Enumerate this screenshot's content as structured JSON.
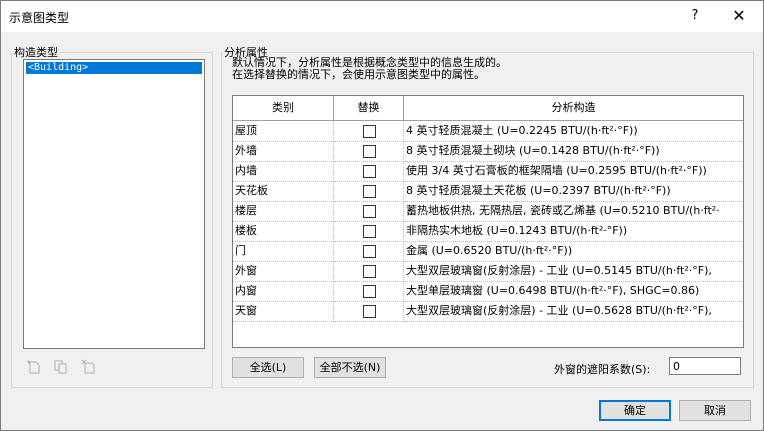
{
  "window": {
    "title": "示意图类型",
    "help_label": "?",
    "close_label": "✕"
  },
  "construction": {
    "legend": "构造类型",
    "items": [
      "<Building>"
    ],
    "icons": [
      "new-type-icon",
      "duplicate-type-icon",
      "delete-type-icon"
    ]
  },
  "analytic": {
    "legend": "分析属性",
    "desc_line1": "默认情况下，分析属性是根据概念类型中的信息生成的。",
    "desc_line2": "在选择替换的情况下，会使用示意图类型中的属性。",
    "headers": {
      "category": "类别",
      "override": "替换",
      "construction": "分析构造"
    },
    "rows": [
      {
        "category": "屋顶",
        "override": false,
        "construction": "4 英寸轻质混凝土 (U=0.2245 BTU/(h·ft²·°F))"
      },
      {
        "category": "外墙",
        "override": false,
        "construction": "8 英寸轻质混凝土砌块 (U=0.1428 BTU/(h·ft²·°F))"
      },
      {
        "category": "内墙",
        "override": false,
        "construction": "使用 3/4 英寸石膏板的框架隔墙 (U=0.2595 BTU/(h·ft²·°F))"
      },
      {
        "category": "天花板",
        "override": false,
        "construction": "8 英寸轻质混凝土天花板 (U=0.2397 BTU/(h·ft²·°F))"
      },
      {
        "category": "楼层",
        "override": false,
        "construction": "蓄热地板供热, 无隔热层, 瓷砖或乙烯基 (U=0.5210 BTU/(h·ft²·"
      },
      {
        "category": "楼板",
        "override": false,
        "construction": "非隔热实木地板 (U=0.1243 BTU/(h·ft²·°F))"
      },
      {
        "category": "门",
        "override": false,
        "construction": "金属 (U=0.6520 BTU/(h·ft²·°F))"
      },
      {
        "category": "外窗",
        "override": false,
        "construction": "大型双层玻璃窗(反射涂层) - 工业 (U=0.5145 BTU/(h·ft²·°F),"
      },
      {
        "category": "内窗",
        "override": false,
        "construction": "大型单层玻璃窗 (U=0.6498 BTU/(h·ft²·°F), SHGC=0.86)"
      },
      {
        "category": "天窗",
        "override": false,
        "construction": "大型双层玻璃窗(反射涂层) - 工业 (U=0.5628 BTU/(h·ft²·°F),"
      }
    ],
    "select_all_label": "全选(L)",
    "select_none_label": "全部不选(N)",
    "shading_label": "外窗的遮阳系数(S):",
    "shading_value": "0"
  },
  "footer": {
    "ok_label": "确定",
    "cancel_label": "取消"
  }
}
